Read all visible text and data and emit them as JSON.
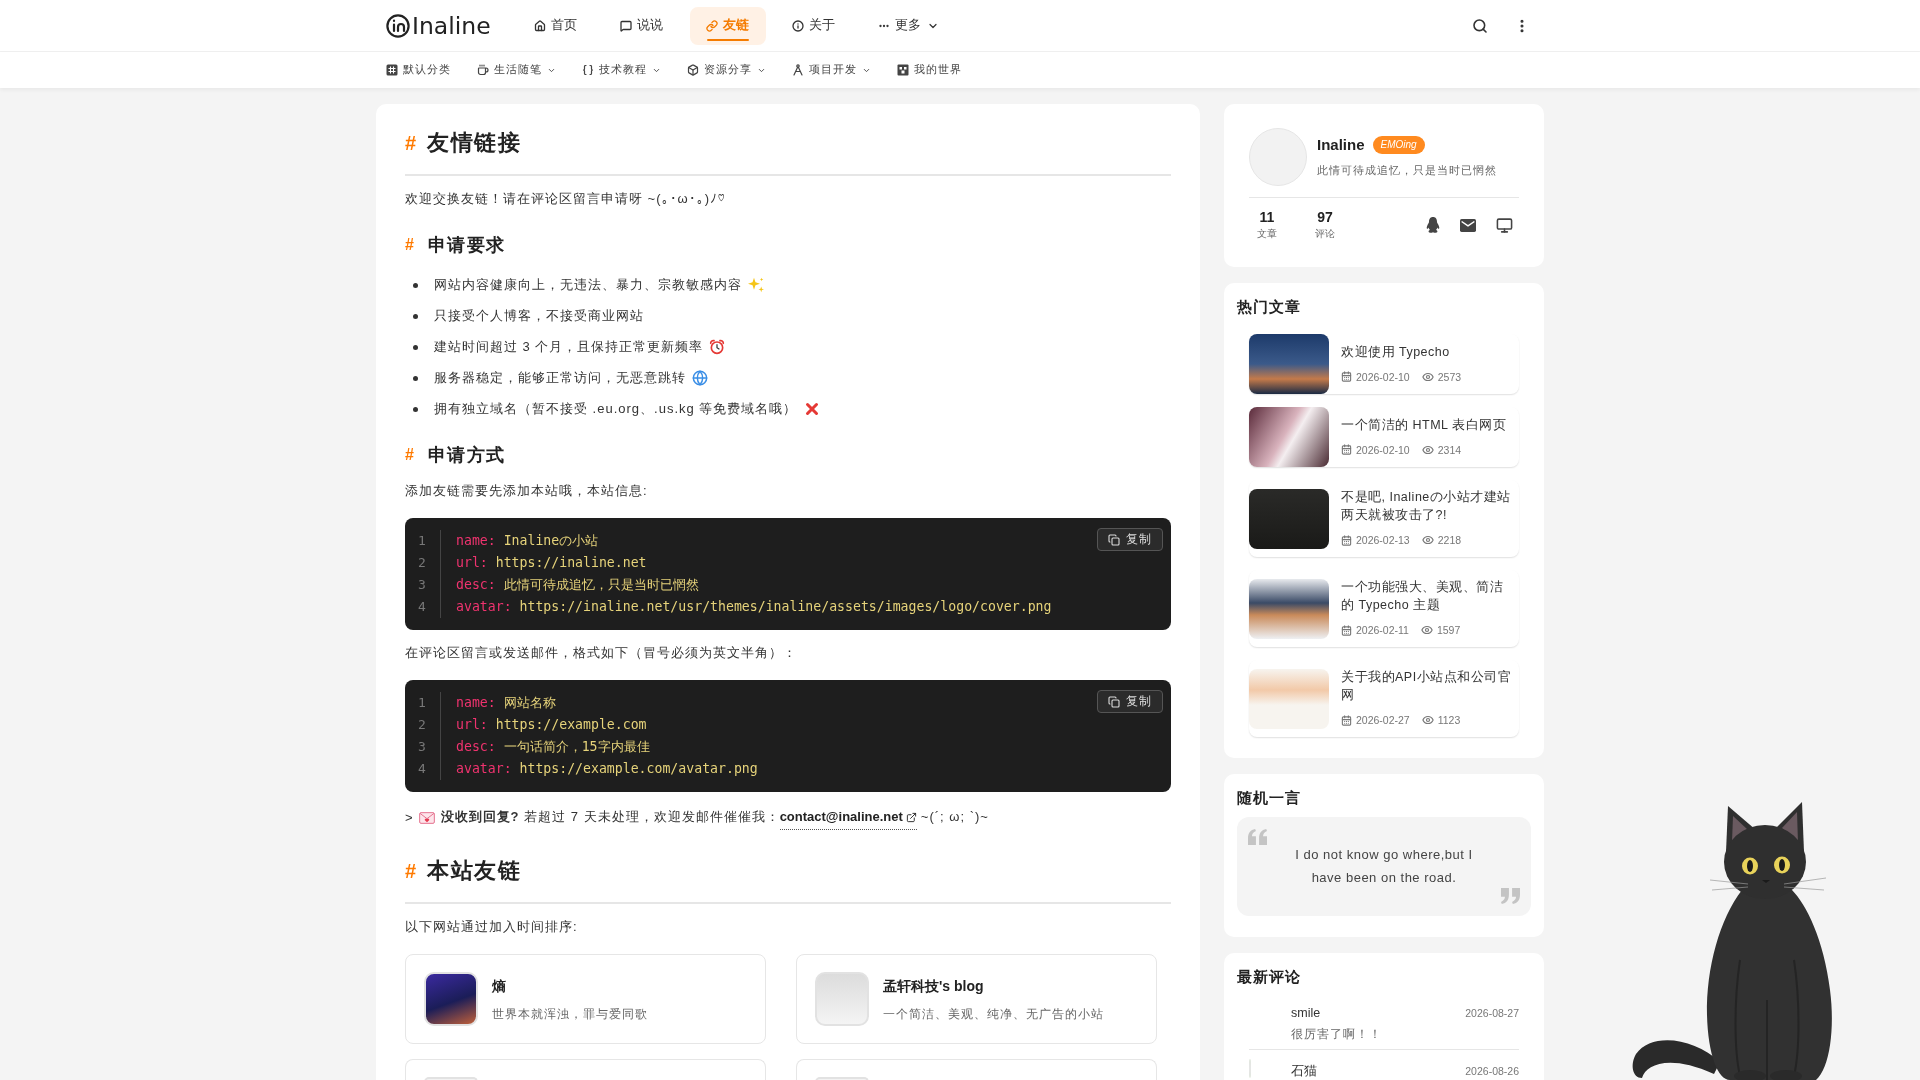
{
  "header": {
    "logo": "Inaline",
    "nav": [
      {
        "label": "首页",
        "selected": false,
        "dropdown": false
      },
      {
        "label": "说说",
        "selected": false,
        "dropdown": false
      },
      {
        "label": "友链",
        "selected": true,
        "dropdown": false
      },
      {
        "label": "关于",
        "selected": false,
        "dropdown": false
      },
      {
        "label": "更多",
        "selected": false,
        "dropdown": true
      }
    ]
  },
  "categories": [
    {
      "label": "默认分类",
      "selected": false,
      "dropdown": false
    },
    {
      "label": "生活随笔",
      "selected": false,
      "dropdown": true
    },
    {
      "label": "技术教程",
      "selected": false,
      "dropdown": true
    },
    {
      "label": "资源分享",
      "selected": false,
      "dropdown": true
    },
    {
      "label": "项目开发",
      "selected": false,
      "dropdown": true
    },
    {
      "label": "我的世界",
      "selected": false,
      "dropdown": false
    }
  ],
  "article": {
    "blocks": [
      {
        "kind": "h1",
        "marker": "#",
        "text": "友情链接"
      },
      {
        "kind": "paragraph",
        "text": "欢迎交换友链！请在评论区留言申请呀 ~(｡･ω･｡)ﾉ♡"
      },
      {
        "kind": "h2",
        "marker": "#",
        "text": "申请要求"
      },
      {
        "kind": "list",
        "items": [
          "网站内容健康向上，无违法、暴力、宗教敏感内容",
          "只接受个人博客，不接受商业网站",
          "建站时间超过 3 个月，且保持正常更新频率",
          "服务器稳定，能够正常访问，无恶意跳转",
          "拥有独立域名（暂不接受 .eu.org、.us.kg 等免费域名哦）"
        ]
      },
      {
        "kind": "h2",
        "marker": "#",
        "text": "申请方式"
      },
      {
        "kind": "paragraph",
        "text": "添加友链需要先添加本站哦，本站信息:"
      },
      {
        "kind": "code",
        "copy_label": "复制",
        "lines": [
          {
            "number": "1",
            "key": "name:",
            "value": "Inalineの小站"
          },
          {
            "number": "2",
            "key": "url:",
            "value": "https://inaline.net"
          },
          {
            "number": "3",
            "key": "desc:",
            "value": "此情可待成追忆，只是当时已惘然"
          },
          {
            "number": "4",
            "key": "avatar:",
            "value": "https://inaline.net/usr/themes/inaline/assets/images/logo/cover.png"
          }
        ]
      },
      {
        "kind": "paragraph",
        "text": "在评论区留言或发送邮件，格式如下（冒号必须为英文半角）："
      },
      {
        "kind": "code",
        "copy_label": "复制",
        "lines": [
          {
            "number": "1",
            "key": "name:",
            "value": "网站名称"
          },
          {
            "number": "2",
            "key": "url:",
            "value": "https://example.com"
          },
          {
            "number": "3",
            "key": "desc:",
            "value": "一句话简介，15字内最佳"
          },
          {
            "number": "4",
            "key": "avatar:",
            "value": "https://example.com/avatar.png"
          }
        ]
      },
      {
        "kind": "note",
        "marker": ">",
        "lead": "**没收到回复?** 若超过 7 天未处理，欢迎发邮件催催我：",
        "link": "contact@inaline.net",
        "tail": "~(´; ω; `)~"
      },
      {
        "kind": "h1",
        "marker": "#",
        "text": "本站友链"
      },
      {
        "kind": "paragraph",
        "text": "以下网站通过加入时间排序:"
      },
      {
        "kind": "links",
        "items": [
          {
            "kind": "site",
            "name": "熵",
            "desc": "世界本就浑浊，罪与爱同歌"
          },
          {
            "kind": "site",
            "name": "孟轩科技's blog",
            "desc": "一个简洁、美观、纯净、无广告的小站"
          },
          {
            "kind": "cut"
          },
          {
            "kind": "cut"
          }
        ]
      }
    ]
  },
  "sidebar": {
    "profile": {
      "name": "Inaline",
      "badge": "EMOing",
      "motto": "此情可待成追忆，只是当时已惘然",
      "stats": [
        {
          "value": "11",
          "label": "文章"
        },
        {
          "value": "97",
          "label": "评论"
        }
      ]
    },
    "hot_articles": {
      "title": "热门文章",
      "items": [
        {
          "title": "欢迎使用 Typecho",
          "date": "2026-02-10",
          "views": "2573"
        },
        {
          "title": "一个简洁的 HTML 表白网页",
          "date": "2026-02-10",
          "views": "2314"
        },
        {
          "title": "不是吧, Inalineの小站才建站两天就被攻击了?!",
          "date": "2026-02-13",
          "views": "2218"
        },
        {
          "title": "一个功能强大、美观、简洁的 Typecho 主题",
          "date": "2026-02-11",
          "views": "1597"
        },
        {
          "title": "关于我的API小站点和公司官网",
          "date": "2026-02-27",
          "views": "1123"
        }
      ]
    },
    "quote": {
      "title": "随机一言",
      "text": "I do not know go where,but I have been on the road."
    },
    "comments": {
      "title": "最新评论",
      "items": [
        {
          "author": "smile",
          "date": "2026-08-27",
          "text": "很厉害了啊！！",
          "has_avatar": false
        },
        {
          "author": "石猫",
          "date": "2026-08-26",
          "has_avatar": true
        }
      ]
    }
  }
}
